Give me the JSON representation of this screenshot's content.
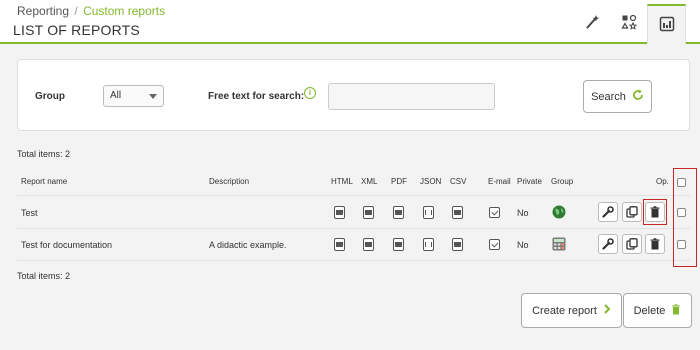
{
  "header": {
    "breadcrumb_root": "Reporting",
    "breadcrumb_sep": "/",
    "breadcrumb_current": "Custom reports",
    "title": "LIST OF REPORTS",
    "icons": [
      "wizard-icon",
      "shapes-icon",
      "report-list-icon"
    ]
  },
  "search": {
    "group_label": "Group",
    "group_value": "All",
    "free_text_label": "Free text for search:",
    "free_text_value": "",
    "button_label": "Search"
  },
  "total_top": "Total items: 2",
  "total_bottom": "Total items: 2",
  "table": {
    "headers": {
      "name": "Report name",
      "description": "Description",
      "html": "HTML",
      "xml": "XML",
      "pdf": "PDF",
      "json": "JSON",
      "csv": "CSV",
      "email": "E-mail",
      "private": "Private",
      "group": "Group",
      "op": "Op."
    },
    "rows": [
      {
        "name": "Test",
        "description": "",
        "private": "No",
        "group_icon": "globe-icon"
      },
      {
        "name": "Test for documentation",
        "description": "A didactic example.",
        "private": "No",
        "group_icon": "calculator-icon"
      }
    ]
  },
  "actions": {
    "create_label": "Create report",
    "delete_label": "Delete"
  },
  "colors": {
    "accent": "#82b92e",
    "highlight": "#c62828"
  }
}
